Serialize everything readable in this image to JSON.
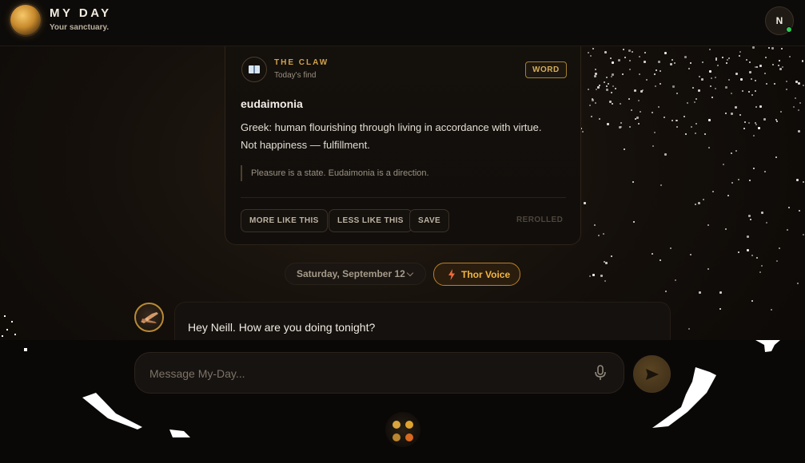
{
  "header": {
    "app_title": "MY DAY",
    "app_subtitle": "Your sanctuary.",
    "avatar_initial": "N"
  },
  "card": {
    "kicker": "THE CLAW",
    "kicker_sub": "Today's find",
    "badge": "WORD",
    "word": "eudaimonia",
    "definition": "Greek: human flourishing through living in accordance with virtue. Not happiness — fulfillment.",
    "quote": "Pleasure is a state. Eudaimonia is a direction.",
    "actions": {
      "more_like_this": "MORE LIKE THIS",
      "less_like_this": "LESS LIKE THIS",
      "save": "SAVE"
    },
    "status": "REROLLED"
  },
  "date_selector": {
    "label": "Saturday, September 12"
  },
  "voice": {
    "label": "Thor Voice",
    "accent": "#f2b640"
  },
  "chat": {
    "messages": [
      {
        "sender": "assistant",
        "text": "Hey Neill. How are you doing tonight?"
      }
    ]
  },
  "composer": {
    "placeholder": "Message My-Day...",
    "value": ""
  },
  "icons": {
    "logo": "sun-orb-icon",
    "card": "book-icon",
    "voice": "bolt-icon",
    "mic": "microphone-icon",
    "send": "send-icon",
    "menu": "dots-grid-icon"
  },
  "colors": {
    "accent_gold": "#d1a24e",
    "online": "#2ecc55"
  }
}
